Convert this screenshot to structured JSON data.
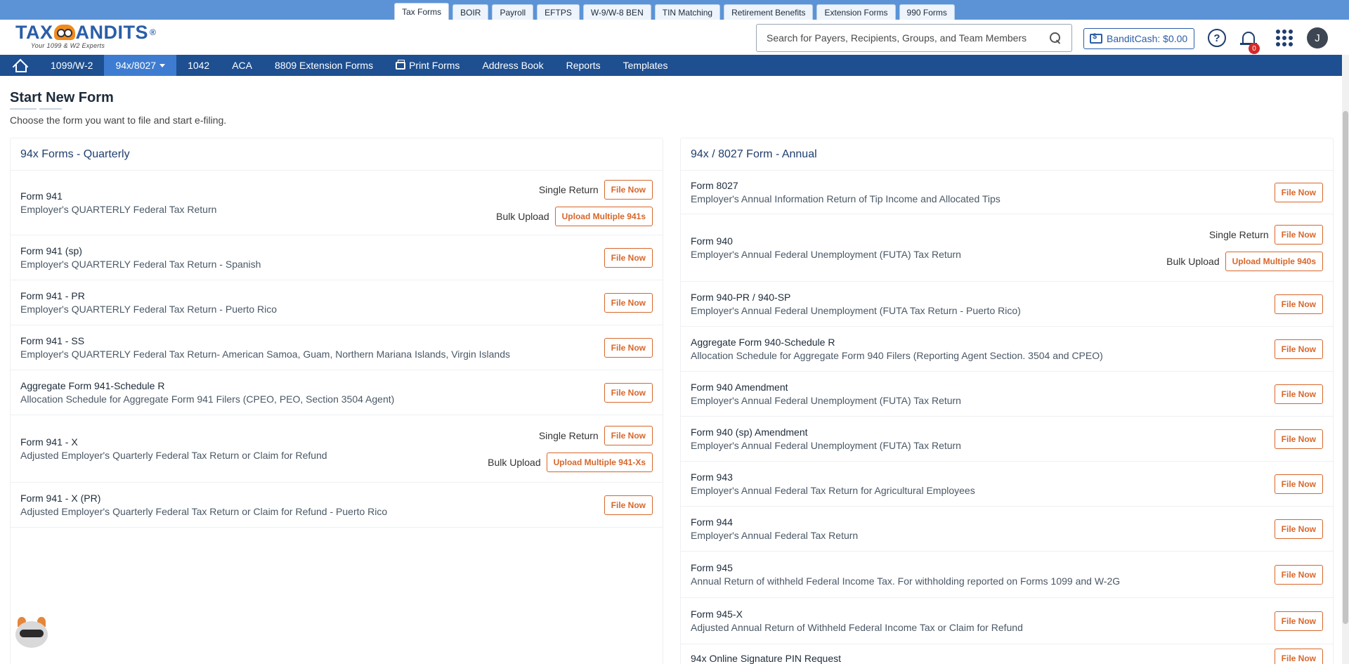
{
  "product_tabs": [
    {
      "label": "Tax Forms",
      "active": true
    },
    {
      "label": "BOIR",
      "active": false
    },
    {
      "label": "Payroll",
      "active": false
    },
    {
      "label": "EFTPS",
      "active": false
    },
    {
      "label": "W-9/W-8 BEN",
      "active": false
    },
    {
      "label": "TIN Matching",
      "active": false
    },
    {
      "label": "Retirement Benefits",
      "active": false
    },
    {
      "label": "Extension Forms",
      "active": false
    },
    {
      "label": "990 Forms",
      "active": false
    }
  ],
  "header": {
    "logo_text_left": "TAX",
    "logo_text_right": "ANDITS",
    "logo_reg": "®",
    "logo_tagline": "Your 1099 & W2 Experts",
    "search_placeholder": "Search for Payers, Recipients, Groups, and Team Members",
    "bandit_cash": "BanditCash: $0.00",
    "help_symbol": "?",
    "notification_count": "0",
    "avatar_initial": "J",
    "icons": [
      "search-icon",
      "wallet-icon",
      "help-icon",
      "bell-icon",
      "apps-grid-icon"
    ]
  },
  "nav": {
    "items": [
      {
        "label": "1099/W-2",
        "active": false
      },
      {
        "label": "94x/8027",
        "active": true
      },
      {
        "label": "1042",
        "active": false
      },
      {
        "label": "ACA",
        "active": false
      },
      {
        "label": "8809 Extension Forms",
        "active": false
      },
      {
        "label": "Print Forms",
        "active": false
      },
      {
        "label": "Address Book",
        "active": false
      },
      {
        "label": "Reports",
        "active": false
      },
      {
        "label": "Templates",
        "active": false
      }
    ]
  },
  "page": {
    "title": "Start New Form",
    "subtitle": "Choose the form you want to file and start e-filing."
  },
  "labels": {
    "single_return": "Single Return",
    "bulk_upload": "Bulk Upload",
    "file_now": "File Now"
  },
  "quarterly": {
    "title": "94x Forms - Quarterly",
    "forms": [
      {
        "name": "Form 941",
        "desc": "Employer's QUARTERLY Federal Tax Return",
        "bulk_label": "Upload Multiple 941s"
      },
      {
        "name": "Form 941 (sp)",
        "desc": "Employer's QUARTERLY Federal Tax Return - Spanish"
      },
      {
        "name": "Form 941 - PR",
        "desc": "Employer's QUARTERLY Federal Tax Return - Puerto Rico"
      },
      {
        "name": "Form 941 - SS",
        "desc": "Employer's QUARTERLY Federal Tax Return- American Samoa, Guam, Northern Mariana Islands, Virgin Islands"
      },
      {
        "name": "Aggregate Form 941-Schedule R",
        "desc": "Allocation Schedule for Aggregate Form 941 Filers (CPEO, PEO, Section 3504 Agent)"
      },
      {
        "name": "Form 941 - X",
        "desc": "Adjusted Employer's Quarterly Federal Tax Return or Claim for Refund",
        "bulk_label": "Upload Multiple 941-Xs"
      },
      {
        "name": "Form 941 - X (PR)",
        "desc": "Adjusted Employer's Quarterly Federal Tax Return or Claim for Refund - Puerto Rico"
      }
    ]
  },
  "annual": {
    "title": "94x / 8027 Form - Annual",
    "forms": [
      {
        "name": "Form 8027",
        "desc": "Employer's Annual Information Return of Tip Income and Allocated Tips"
      },
      {
        "name": "Form 940",
        "desc": "Employer's Annual Federal Unemployment (FUTA) Tax Return",
        "bulk_label": "Upload Multiple 940s"
      },
      {
        "name": "Form 940-PR / 940-SP",
        "desc": "Employer's Annual Federal Unemployment (FUTA Tax Return - Puerto Rico)"
      },
      {
        "name": "Aggregate Form 940-Schedule R",
        "desc": "Allocation Schedule for Aggregate Form 940 Filers (Reporting Agent Section. 3504 and CPEO)"
      },
      {
        "name": "Form 940 Amendment",
        "desc": "Employer's Annual Federal Unemployment (FUTA) Tax Return"
      },
      {
        "name": "Form 940 (sp) Amendment",
        "desc": "Employer's Annual Federal Unemployment (FUTA) Tax Return"
      },
      {
        "name": "Form 943",
        "desc": "Employer's Annual Federal Tax Return for Agricultural Employees"
      },
      {
        "name": "Form 944",
        "desc": "Employer's Annual Federal Tax Return"
      },
      {
        "name": "Form 945",
        "desc": "Annual Return of withheld Federal Income Tax. For withholding reported on Forms 1099 and W-2G"
      },
      {
        "name": "Form 945-X",
        "desc": "Adjusted Annual Return of Withheld Federal Income Tax or Claim for Refund"
      },
      {
        "name": "94x Online Signature PIN Request",
        "desc": ""
      }
    ]
  },
  "colors": {
    "strip": "#5b93d6",
    "nav": "#1d4f91",
    "nav_active": "#3d7cd0",
    "accent_orange": "#d8662a",
    "brand_blue": "#2a5ea8",
    "badge_red": "#d62828"
  }
}
